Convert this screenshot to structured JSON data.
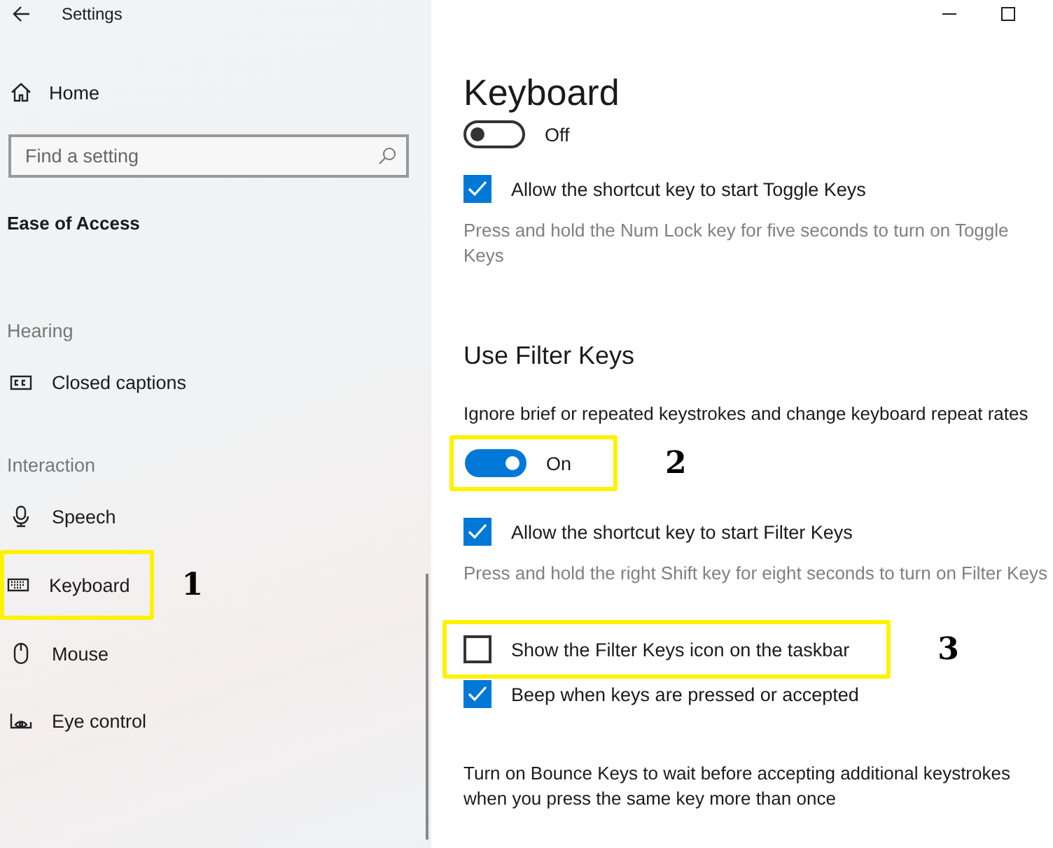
{
  "window": {
    "title": "Settings"
  },
  "sidebar": {
    "home": "Home",
    "search": {
      "placeholder": "Find a setting"
    },
    "category": "Ease of Access",
    "sections": [
      {
        "heading": "Hearing",
        "items": [
          {
            "label": "Closed captions",
            "kind": "captions"
          }
        ]
      },
      {
        "heading": "Interaction",
        "items": [
          {
            "label": "Speech",
            "kind": "mic"
          },
          {
            "label": "Keyboard",
            "kind": "keyboard",
            "callout": "1"
          },
          {
            "label": "Mouse",
            "kind": "mouse"
          },
          {
            "label": "Eye control",
            "kind": "eye"
          }
        ]
      }
    ]
  },
  "main": {
    "title": "Keyboard",
    "settings": [
      {
        "kind": "toggle",
        "on": false,
        "label": "Off"
      },
      {
        "kind": "checkbox",
        "checked": true,
        "label": "Allow the shortcut key to start Toggle Keys"
      },
      {
        "kind": "note",
        "text": "Press and hold the Num Lock key for five seconds to turn on Toggle Keys"
      },
      {
        "kind": "heading",
        "text": "Use Filter Keys"
      },
      {
        "kind": "text",
        "text": "Ignore brief or repeated keystrokes and change keyboard repeat rates"
      },
      {
        "kind": "toggle",
        "on": true,
        "label": "On",
        "callout": "2"
      },
      {
        "kind": "checkbox",
        "checked": true,
        "label": "Allow the shortcut key to start Filter Keys"
      },
      {
        "kind": "note",
        "text": "Press and hold the right Shift key for eight seconds to turn on Filter Keys"
      },
      {
        "kind": "checkbox",
        "checked": false,
        "label": "Show the Filter Keys icon on the taskbar",
        "callout": "3"
      },
      {
        "kind": "checkbox",
        "checked": true,
        "label": "Beep when keys are pressed or accepted"
      },
      {
        "kind": "text",
        "text": "Turn on Bounce Keys to wait before accepting additional keystrokes when you press the same key more than once"
      }
    ]
  }
}
